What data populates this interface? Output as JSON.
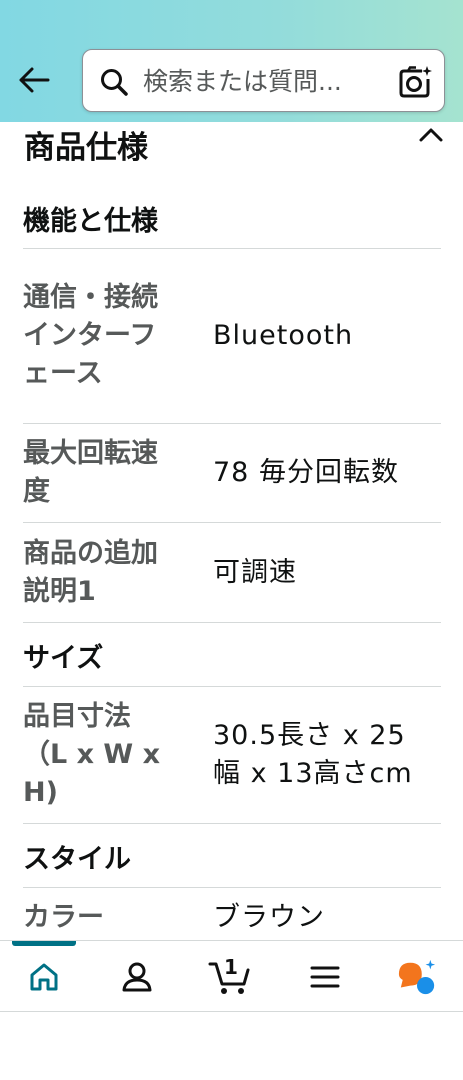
{
  "header": {
    "search_placeholder": "検索または質問..."
  },
  "section": {
    "title": "商品仕様"
  },
  "groups": [
    {
      "title": "機能と仕様",
      "rows": [
        {
          "key": "通信・接続インターフェース",
          "value": "Bluetooth"
        },
        {
          "key": "最大回転速度",
          "value": "78 毎分回転数"
        },
        {
          "key": "商品の追加説明1",
          "value": "可調速"
        }
      ]
    },
    {
      "title": "サイズ",
      "rows": [
        {
          "key": "品目寸法（L x W x H)",
          "value": "30.5長さ x 25幅 x 13高さcm"
        }
      ]
    },
    {
      "title": "スタイル",
      "rows": [
        {
          "key": "カラー",
          "value": "ブラウン"
        }
      ]
    }
  ],
  "bottom_nav": {
    "cart_count": "1"
  },
  "colors": {
    "header_gradient_start": "#82d8e3",
    "header_gradient_end": "#a5e3d0",
    "nav_active": "#007185",
    "key_text": "#565959",
    "divider": "#d5d9d9",
    "rufus_orange": "#f3751d",
    "rufus_blue": "#1a8fe8"
  }
}
